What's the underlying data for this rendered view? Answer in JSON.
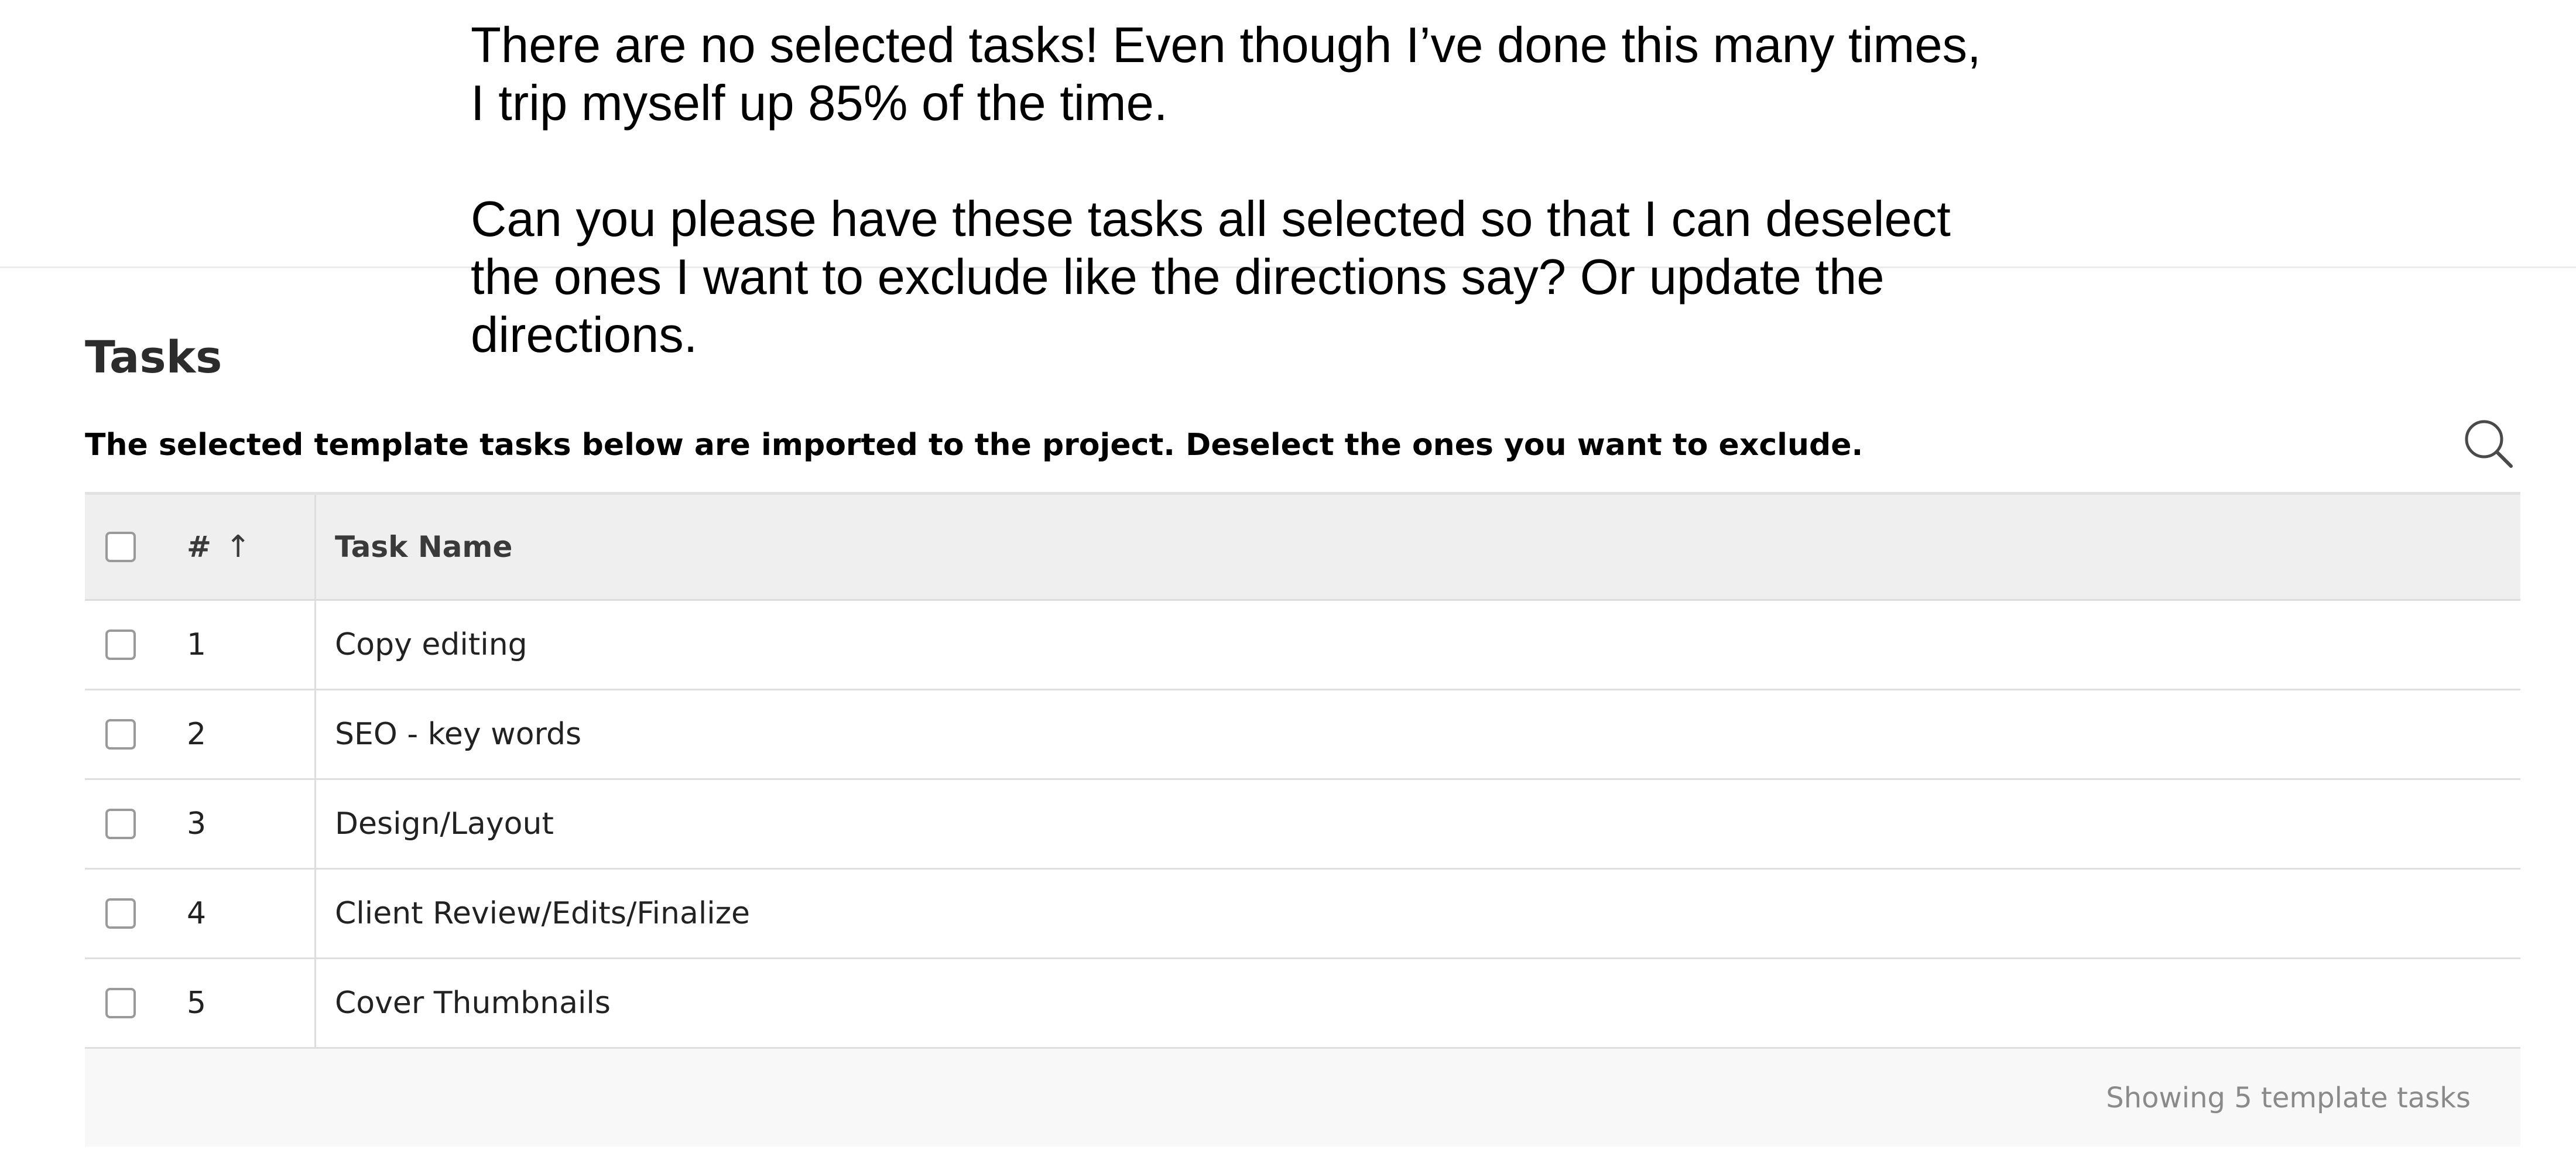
{
  "note": {
    "paragraph_1": "There are no selected tasks!  Even though I’ve done this many times,\nI trip myself up 85% of the time.",
    "paragraph_2": "Can you please have these tasks all selected so that I can deselect\nthe ones I want to exclude like the directions say?  Or update the\ndirections."
  },
  "page": {
    "title": "Tasks",
    "instructions": {
      "part_1": "The ",
      "highlight_1": "selected template tasks below",
      "part_2": " are imported to the project. ",
      "highlight_2": "Deselect the ones you want to exclude",
      "part_3": "."
    },
    "search_icon": "search-icon",
    "highlight_color": "#ffff00"
  },
  "table": {
    "columns": {
      "number": "#",
      "sort_indicator": "↑",
      "name": "Task Name"
    },
    "rows": [
      {
        "number": "1",
        "name": "Copy editing",
        "selected": false
      },
      {
        "number": "2",
        "name": "SEO - key words",
        "selected": false
      },
      {
        "number": "3",
        "name": "Design/Layout",
        "selected": false
      },
      {
        "number": "4",
        "name": "Client Review/Edits/Finalize",
        "selected": false
      },
      {
        "number": "5",
        "name": "Cover Thumbnails",
        "selected": false
      }
    ],
    "footer": "Showing 5 template tasks"
  }
}
